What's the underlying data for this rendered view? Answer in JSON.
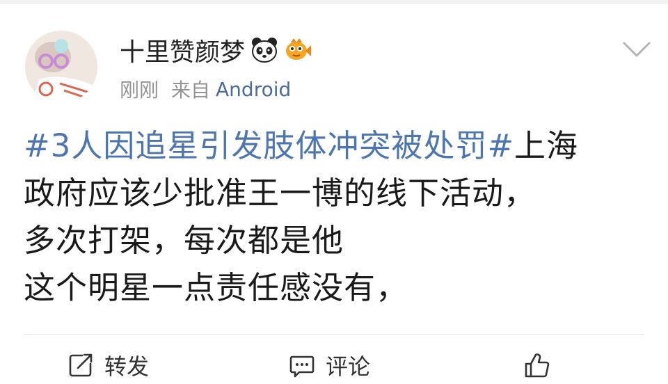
{
  "user": {
    "name": "十里赞颜梦",
    "emoji_icons": [
      "panda-icon",
      "fish-icon"
    ]
  },
  "meta": {
    "time": "刚刚",
    "source_prefix": "来自",
    "device": "Android"
  },
  "post": {
    "hashtag": "#3人因追星引发肢体冲突被处罚#",
    "line1_rest": "上海",
    "line2": "政府应该少批准王一博的线下活动，",
    "line3": "多次打架，每次都是他",
    "line4": "这个明星一点责任感没有，"
  },
  "actions": {
    "repost": "转发",
    "comment": "评论",
    "like": ""
  },
  "colors": {
    "hashtag": "#4d76b0",
    "device": "#4a6b9c",
    "meta": "#939393",
    "text": "#1a1a1a"
  }
}
